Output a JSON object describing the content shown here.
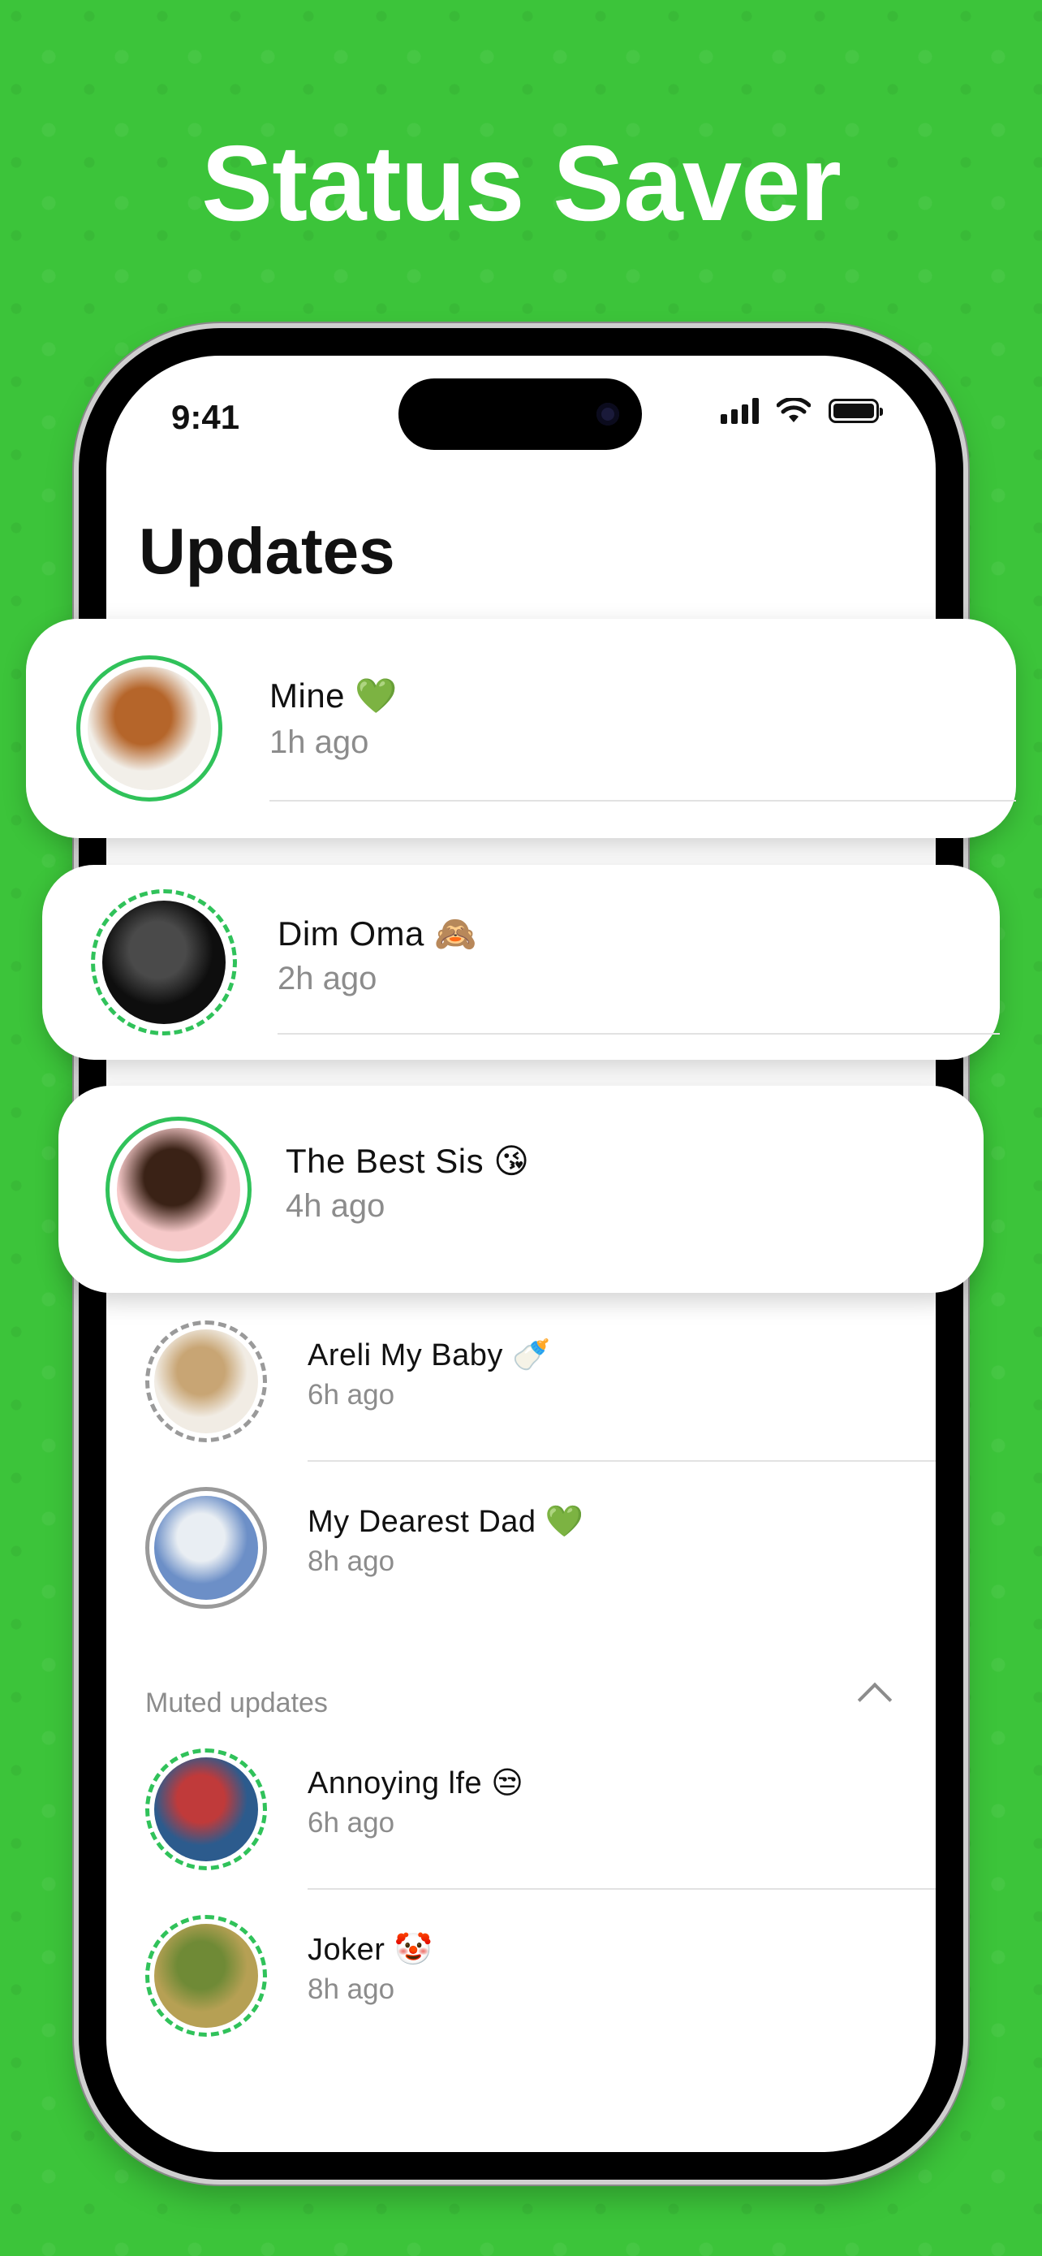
{
  "headline": "Status Saver",
  "status_bar": {
    "time": "9:41"
  },
  "screen_title": "Updates",
  "cards": [
    {
      "name": "Mine",
      "emoji": "💚",
      "ago": "1h ago",
      "ring": "solid",
      "colors": [
        "#f2efe9",
        "#b5652a"
      ]
    },
    {
      "name": "Dim Oma",
      "emoji": "🙈",
      "ago": "2h ago",
      "ring": "dashed-green",
      "colors": [
        "#0e0e0e",
        "#4a4a4a"
      ]
    },
    {
      "name": "The Best Sis",
      "emoji": "😘",
      "ago": "4h ago",
      "ring": "solid",
      "colors": [
        "#f6c9c9",
        "#3a2216"
      ]
    }
  ],
  "updates": [
    {
      "name": "Areli My Baby",
      "emoji": "🍼",
      "ago": "6h ago",
      "ring": "dashed",
      "colors": [
        "#f1ece4",
        "#c8a574"
      ]
    },
    {
      "name": "My Dearest Dad",
      "emoji": "💚",
      "ago": "8h ago",
      "ring": "solid-gray",
      "colors": [
        "#6c8fc7",
        "#e9eef3"
      ]
    }
  ],
  "muted": {
    "label": "Muted updates",
    "items": [
      {
        "name": "Annoying lfe",
        "emoji": "😒",
        "ago": "6h ago",
        "ring": "dashed-green",
        "colors": [
          "#2c5b8d",
          "#c03a3a"
        ]
      },
      {
        "name": "Joker",
        "emoji": "🤡",
        "ago": "8h ago",
        "ring": "dashed-green",
        "colors": [
          "#b6a054",
          "#6f8a36"
        ]
      }
    ]
  },
  "accent": "#30c25a",
  "background": "#3cc43a"
}
